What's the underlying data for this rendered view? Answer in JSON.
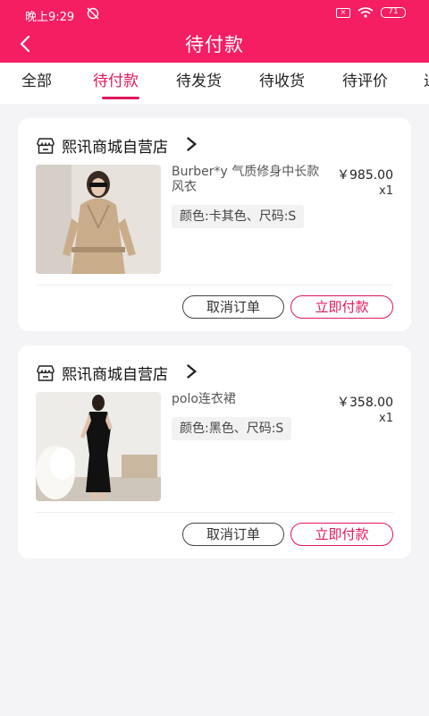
{
  "status_bar": {
    "time": "晚上9:29",
    "sim": "×",
    "battery": "71"
  },
  "header": {
    "title": "待付款"
  },
  "tabs": [
    {
      "label": "全部"
    },
    {
      "label": "待付款"
    },
    {
      "label": "待发货"
    },
    {
      "label": "待收货"
    },
    {
      "label": "待评价"
    },
    {
      "label": "退"
    }
  ],
  "orders": [
    {
      "shop_name": "熙讯商城自营店",
      "product_name": "Burber*y 气质修身中长款风衣",
      "price": "￥985.00",
      "quantity": "x1",
      "spec": "颜色:卡其色、尺码:S",
      "cancel_label": "取消订单",
      "pay_label": "立即付款"
    },
    {
      "shop_name": "熙讯商城自营店",
      "product_name": "polo连衣裙",
      "price": "￥358.00",
      "quantity": "x1",
      "spec": "颜色:黑色、尺码:S",
      "cancel_label": "取消订单",
      "pay_label": "立即付款"
    }
  ],
  "colors": {
    "brand": "#f51e63",
    "accent": "#e0185a",
    "background": "#f4f4f6"
  }
}
